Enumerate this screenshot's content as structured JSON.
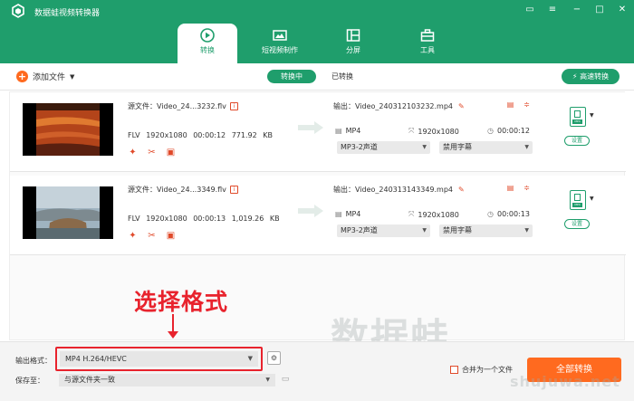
{
  "app": {
    "title": "数据蛙视频转换器"
  },
  "tabs": [
    {
      "label": "转换",
      "icon": "convert-icon",
      "active": true
    },
    {
      "label": "短视频制作",
      "icon": "video-maker-icon",
      "active": false
    },
    {
      "label": "分屏",
      "icon": "split-screen-icon",
      "active": false
    },
    {
      "label": "工具",
      "icon": "toolbox-icon",
      "active": false
    }
  ],
  "toolbar": {
    "add_file_label": "添加文件",
    "converting_label": "转换中",
    "converted_label": "已转换",
    "fast_convert_label": "高速转换"
  },
  "files": [
    {
      "source_label": "源文件：",
      "source_name": "Video_24...3232.flv",
      "format": "FLV",
      "resolution": "1920x1080",
      "duration": "00:00:12",
      "size": "771.92 KB",
      "output_label": "输出：",
      "output_name": "Video_240312103232.mp4",
      "out_format": "MP4",
      "out_resolution": "1920x1080",
      "out_duration": "00:00:12",
      "audio_track": "MP3-2声道",
      "subtitle": "禁用字幕",
      "settings_label": "设置"
    },
    {
      "source_label": "源文件：",
      "source_name": "Video_24...3349.flv",
      "format": "FLV",
      "resolution": "1920x1080",
      "duration": "00:00:13",
      "size": "1,019.26 KB",
      "output_label": "输出：",
      "output_name": "Video_240313143349.mp4",
      "out_format": "MP4",
      "out_resolution": "1920x1080",
      "out_duration": "00:00:13",
      "audio_track": "MP3-2声道",
      "subtitle": "禁用字幕",
      "settings_label": "设置"
    }
  ],
  "annotation": {
    "text": "选择格式"
  },
  "watermark": {
    "main": "数据蛙",
    "url": "shujuwa.net"
  },
  "bottom": {
    "output_format_label": "输出格式：",
    "output_format_value": "MP4 H.264/HEVC",
    "save_to_label": "保存至：",
    "save_to_value": "与源文件夹一致",
    "merge_label": "合并为一个文件",
    "convert_all_label": "全部转换"
  },
  "colors": {
    "primary": "#1f9e6c",
    "accent": "#ff6a1f",
    "highlight": "#e8232d"
  }
}
